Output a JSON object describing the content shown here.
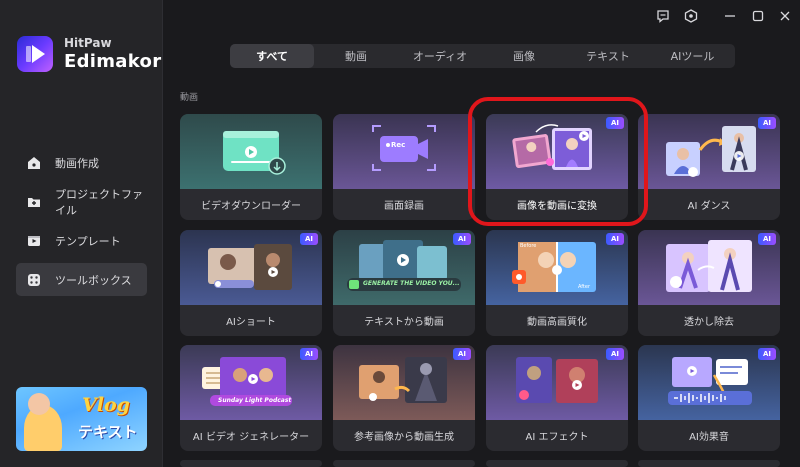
{
  "app": {
    "brand_top": "HitPaw",
    "brand_main": "Edimakor"
  },
  "sidebar": {
    "items": [
      {
        "label": "動画作成",
        "icon": "home-icon",
        "active": false
      },
      {
        "label": "プロジェクトファイル",
        "icon": "folder-plus-icon",
        "active": false
      },
      {
        "label": "テンプレート",
        "icon": "template-icon",
        "active": false
      },
      {
        "label": "ツールボックス",
        "icon": "toolbox-icon",
        "active": true
      }
    ],
    "promo": {
      "title": "Vlog",
      "subtitle": "テキスト"
    }
  },
  "tabs": [
    {
      "label": "すべて",
      "active": true
    },
    {
      "label": "動画",
      "active": false
    },
    {
      "label": "オーディオ",
      "active": false
    },
    {
      "label": "画像",
      "active": false
    },
    {
      "label": "テキスト",
      "active": false
    },
    {
      "label": "AIツール",
      "active": false
    }
  ],
  "section": {
    "label": "動画"
  },
  "ai_badge": "AI",
  "cards": [
    {
      "label": "ビデオダウンローダー",
      "ai": false,
      "icon": "video-download-icon"
    },
    {
      "label": "画面録画",
      "ai": false,
      "icon": "screen-record-icon",
      "rec": "Rec"
    },
    {
      "label": "画像を動画に変換",
      "ai": true,
      "icon": "image-to-video-icon",
      "highlighted": true
    },
    {
      "label": "AI ダンス",
      "ai": true,
      "icon": "ai-dance-icon"
    },
    {
      "label": "AIショート",
      "ai": true,
      "icon": "ai-short-icon"
    },
    {
      "label": "テキストから動画",
      "ai": true,
      "icon": "text-to-video-icon",
      "prompt": "GENERATE THE VIDEO YOU..."
    },
    {
      "label": "動画高画質化",
      "ai": true,
      "icon": "video-enhance-icon",
      "before": "Before",
      "after": "After"
    },
    {
      "label": "透かし除去",
      "ai": true,
      "icon": "watermark-remove-icon"
    },
    {
      "label": "AI ビデオ ジェネレーター",
      "ai": true,
      "icon": "ai-video-generator-icon",
      "caption": "Sunday Light Podcast"
    },
    {
      "label": "参考画像から動画生成",
      "ai": true,
      "icon": "reference-image-video-icon"
    },
    {
      "label": "AI エフェクト",
      "ai": true,
      "icon": "ai-effect-icon"
    },
    {
      "label": "AI効果音",
      "ai": true,
      "icon": "ai-sound-effect-icon"
    }
  ],
  "colors": {
    "accent": "#7b4dff",
    "highlight_ring": "#e0161b",
    "background": "#1a1a1d",
    "sidebar": "#252528"
  }
}
